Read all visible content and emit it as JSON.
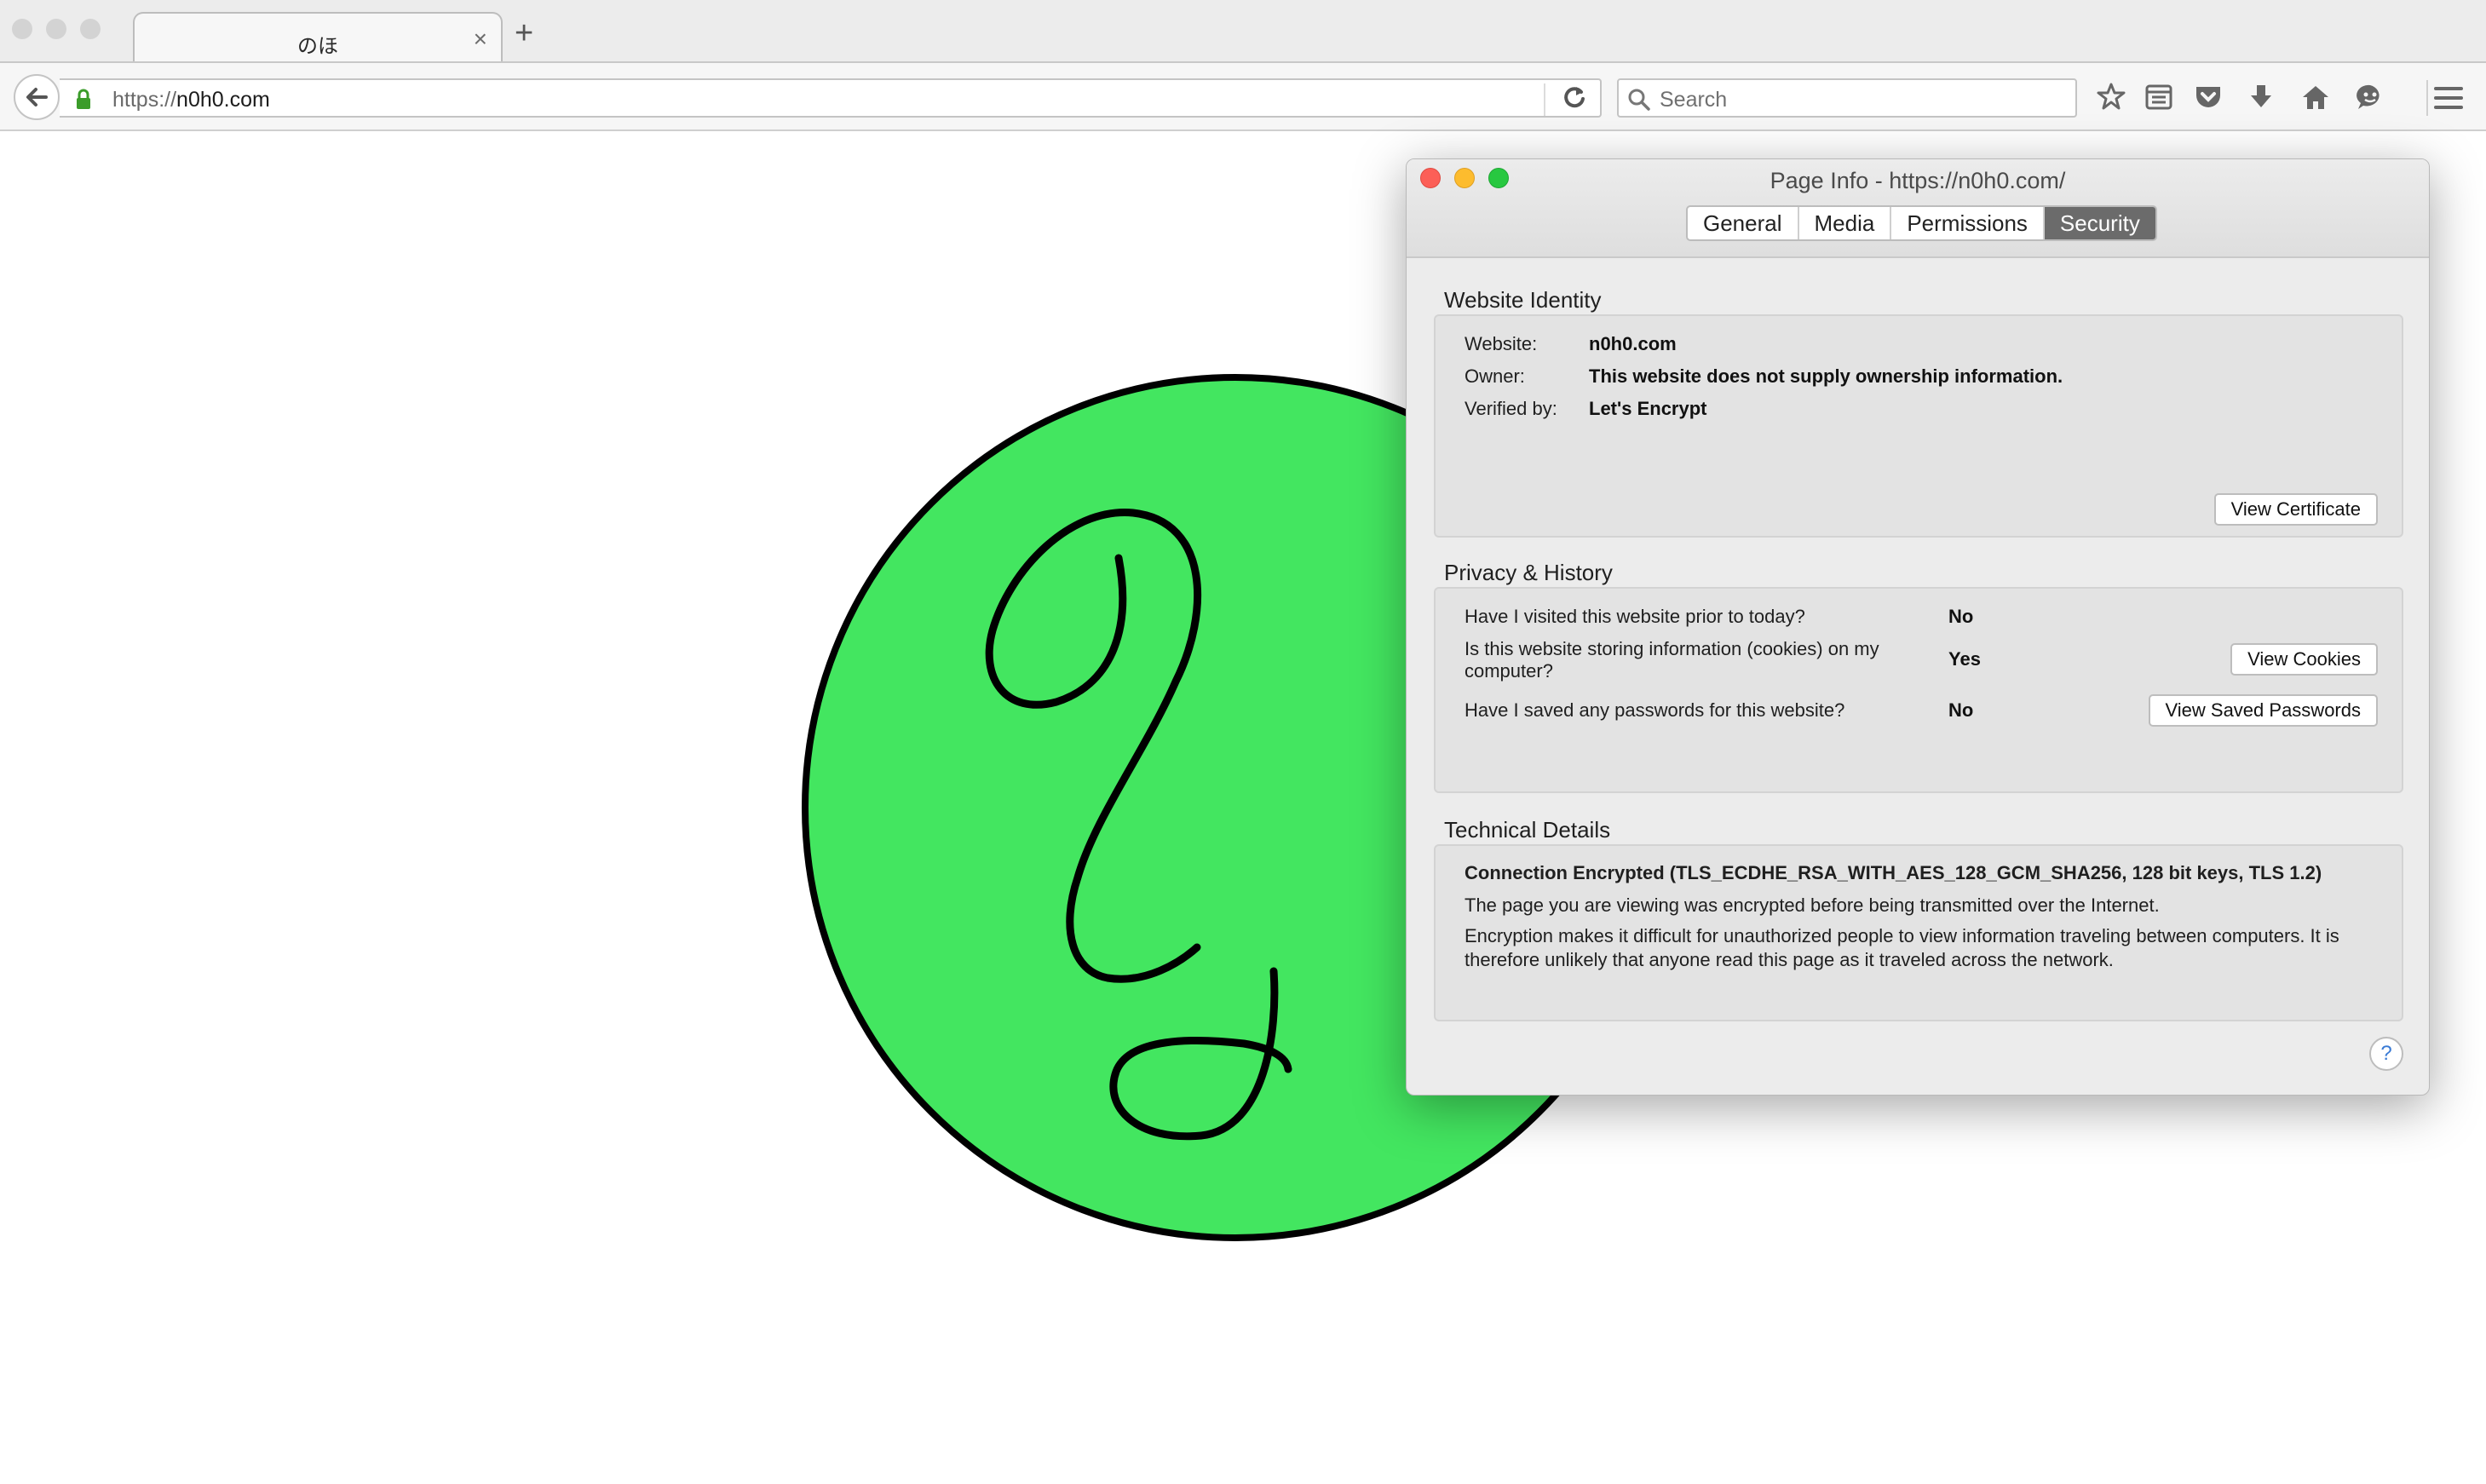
{
  "browser": {
    "tab": {
      "title": "のほ",
      "close_glyph": "×"
    },
    "new_tab_glyph": "+",
    "url": {
      "scheme": "https://",
      "host": "n0h0.com"
    },
    "search_placeholder": "Search",
    "toolbar_icons": [
      "bookmark-star-icon",
      "reading-list-icon",
      "pocket-icon",
      "download-icon",
      "home-icon",
      "chat-icon",
      "menu-icon"
    ]
  },
  "page": {
    "logo_color": "#43e660"
  },
  "page_info": {
    "title": "Page Info - https://n0h0.com/",
    "tabs": [
      "General",
      "Media",
      "Permissions",
      "Security"
    ],
    "active_tab": "Security",
    "website_identity": {
      "heading": "Website Identity",
      "website_label": "Website:",
      "website_value": "n0h0.com",
      "owner_label": "Owner:",
      "owner_value": "This website does not supply ownership information.",
      "verified_label": "Verified by:",
      "verified_value": "Let's Encrypt",
      "view_certificate": "View Certificate"
    },
    "privacy": {
      "heading": "Privacy & History",
      "q1": "Have I visited this website prior to today?",
      "a1": "No",
      "q2_line1": "Is this website storing information (cookies) on my",
      "q2_line2": "computer?",
      "a2": "Yes",
      "view_cookies": "View Cookies",
      "q3": "Have I saved any passwords for this website?",
      "a3": "No",
      "view_passwords": "View Saved Passwords"
    },
    "technical": {
      "heading": "Technical Details",
      "connection": "Connection Encrypted (TLS_ECDHE_RSA_WITH_AES_128_GCM_SHA256, 128 bit keys, TLS 1.2)",
      "line1": "The page you are viewing was encrypted before being transmitted over the Internet.",
      "line2": "Encryption makes it difficult for unauthorized people to view information traveling between computers. It is therefore unlikely that anyone read this page as it traveled across the network."
    },
    "help": "?"
  }
}
